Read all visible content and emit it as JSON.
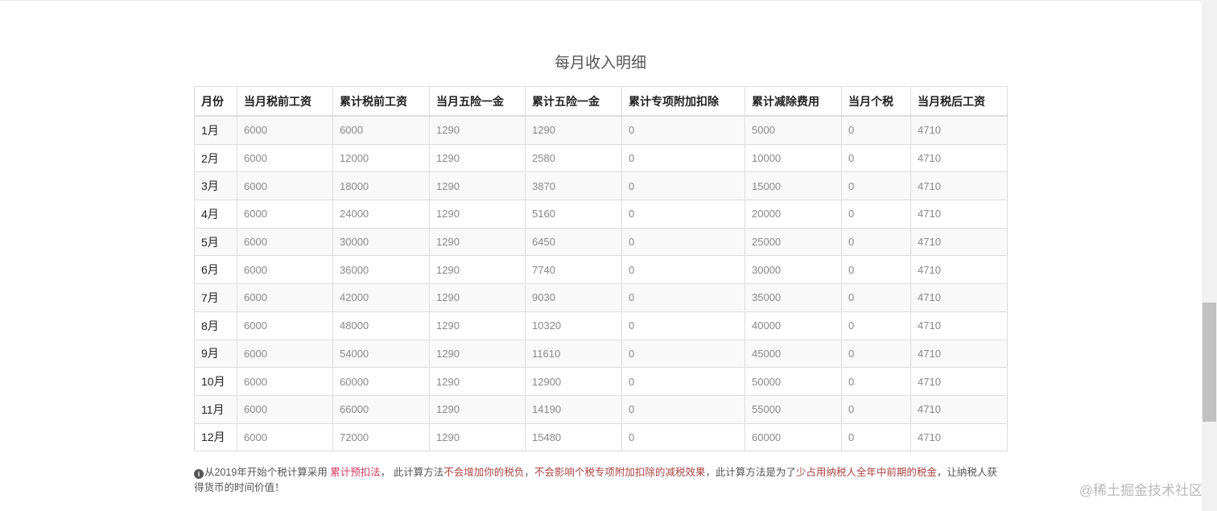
{
  "title": "每月收入明细",
  "table": {
    "headers": [
      "月份",
      "当月税前工资",
      "累计税前工资",
      "当月五险一金",
      "累计五险一金",
      "累计专项附加扣除",
      "累计减除费用",
      "当月个税",
      "当月税后工资"
    ],
    "rows": [
      [
        "1月",
        "6000",
        "6000",
        "1290",
        "1290",
        "0",
        "5000",
        "0",
        "4710"
      ],
      [
        "2月",
        "6000",
        "12000",
        "1290",
        "2580",
        "0",
        "10000",
        "0",
        "4710"
      ],
      [
        "3月",
        "6000",
        "18000",
        "1290",
        "3870",
        "0",
        "15000",
        "0",
        "4710"
      ],
      [
        "4月",
        "6000",
        "24000",
        "1290",
        "5160",
        "0",
        "20000",
        "0",
        "4710"
      ],
      [
        "5月",
        "6000",
        "30000",
        "1290",
        "6450",
        "0",
        "25000",
        "0",
        "4710"
      ],
      [
        "6月",
        "6000",
        "36000",
        "1290",
        "7740",
        "0",
        "30000",
        "0",
        "4710"
      ],
      [
        "7月",
        "6000",
        "42000",
        "1290",
        "9030",
        "0",
        "35000",
        "0",
        "4710"
      ],
      [
        "8月",
        "6000",
        "48000",
        "1290",
        "10320",
        "0",
        "40000",
        "0",
        "4710"
      ],
      [
        "9月",
        "6000",
        "54000",
        "1290",
        "11610",
        "0",
        "45000",
        "0",
        "4710"
      ],
      [
        "10月",
        "6000",
        "60000",
        "1290",
        "12900",
        "0",
        "50000",
        "0",
        "4710"
      ],
      [
        "11月",
        "6000",
        "66000",
        "1290",
        "14190",
        "0",
        "55000",
        "0",
        "4710"
      ],
      [
        "12月",
        "6000",
        "72000",
        "1290",
        "15480",
        "0",
        "60000",
        "0",
        "4710"
      ]
    ]
  },
  "note": {
    "icon": "info-circle-icon",
    "part1": "从2019年开始个税计算采用 ",
    "link": "累计预扣法",
    "part2": "， 此计算方法",
    "hl1": "不会增加你的税负",
    "part3": "，",
    "hl2": "不会影响个税专项附加扣除的减税效果",
    "part4": "，此计算方法是为了",
    "hl3": "少占用纳税人全年中前期的税金",
    "part5": "，让纳税人获得货币的时间价值！"
  },
  "watermark": "@稀土掘金技术社区",
  "colors": {
    "link": "#d33a62",
    "highlight": "#a94442",
    "stripe": "#f9f9f9",
    "border": "#dddddd"
  }
}
